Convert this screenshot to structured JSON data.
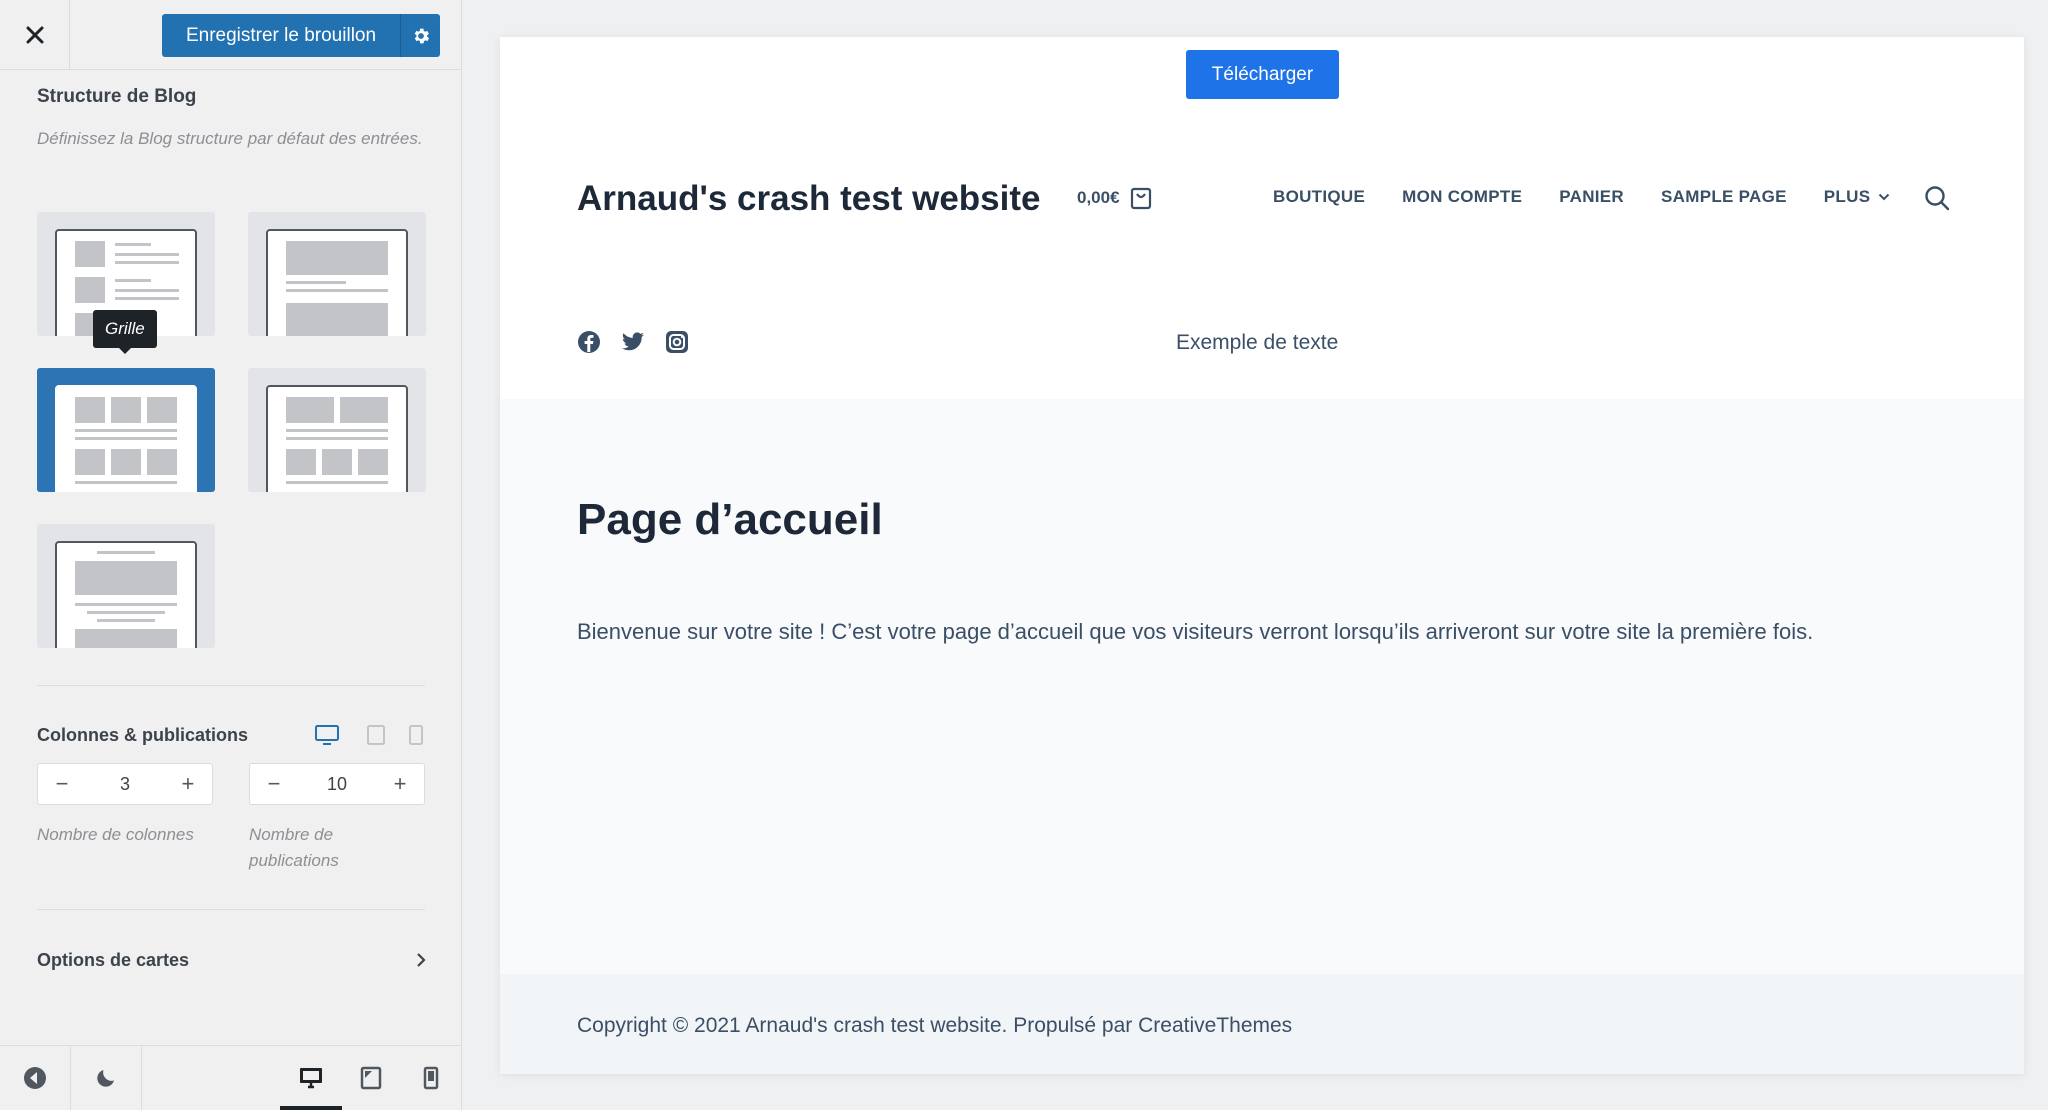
{
  "topbar": {
    "save_label": "Enregistrer le brouillon"
  },
  "panel": {
    "title": "Structure de Blog",
    "description": "Définissez la Blog structure par défaut des entrées.",
    "tooltip": "Grille"
  },
  "columns": {
    "title": "Colonnes & publications",
    "columns_value": "3",
    "posts_value": "10",
    "minus": "−",
    "plus": "+",
    "columns_label": "Nombre de colonnes",
    "posts_label": "Nombre de publications"
  },
  "card_options": {
    "label": "Options de cartes"
  },
  "preview": {
    "download_label": "Télécharger",
    "site_title": "Arnaud's crash test website",
    "cart_amount": "0,00€",
    "nav": [
      "BOUTIQUE",
      "MON COMPTE",
      "PANIER",
      "SAMPLE PAGE",
      "PLUS"
    ],
    "sample_text": "Exemple de texte",
    "page_title": "Page d’accueil",
    "page_body": "Bienvenue sur votre site ! C’est votre page d’accueil que vos visiteurs verront lorsqu’ils arriveront sur votre site la première fois.",
    "copyright": "Copyright © 2021 Arnaud's crash test website. Propulsé par CreativeThemes"
  },
  "colors": {
    "accent": "#2271b1",
    "button_blue": "#1e73e8",
    "active_layout": "#2c74b3",
    "heading": "#1d2938"
  }
}
